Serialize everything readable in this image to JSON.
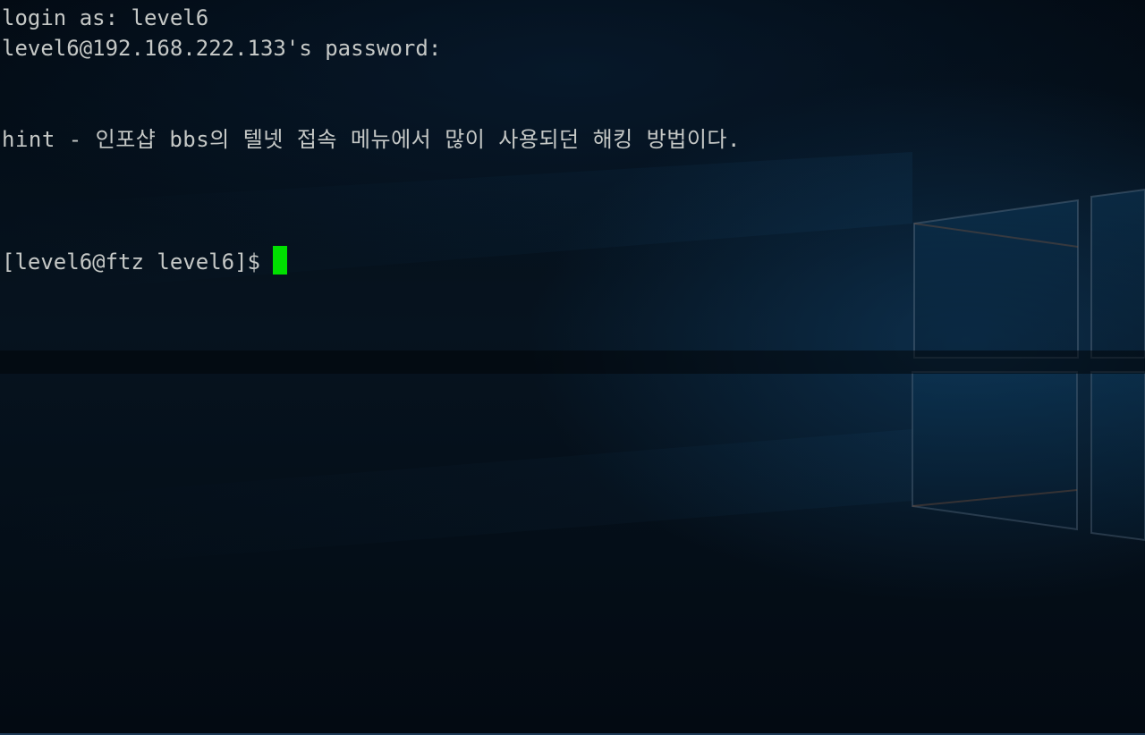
{
  "terminal": {
    "login_line": "login as: level6",
    "password_line": "level6@192.168.222.133's password:",
    "hint_line": "hint - 인포샵 bbs의 텔넷 접속 메뉴에서 많이 사용되던 해킹 방법이다.",
    "prompt": "[level6@ftz level6]$",
    "cursor_color": "#00e000",
    "text_color": "#c5c8c6"
  },
  "background": {
    "wallpaper": "windows-10-desktop-wallpaper",
    "base_color": "#02070d"
  }
}
